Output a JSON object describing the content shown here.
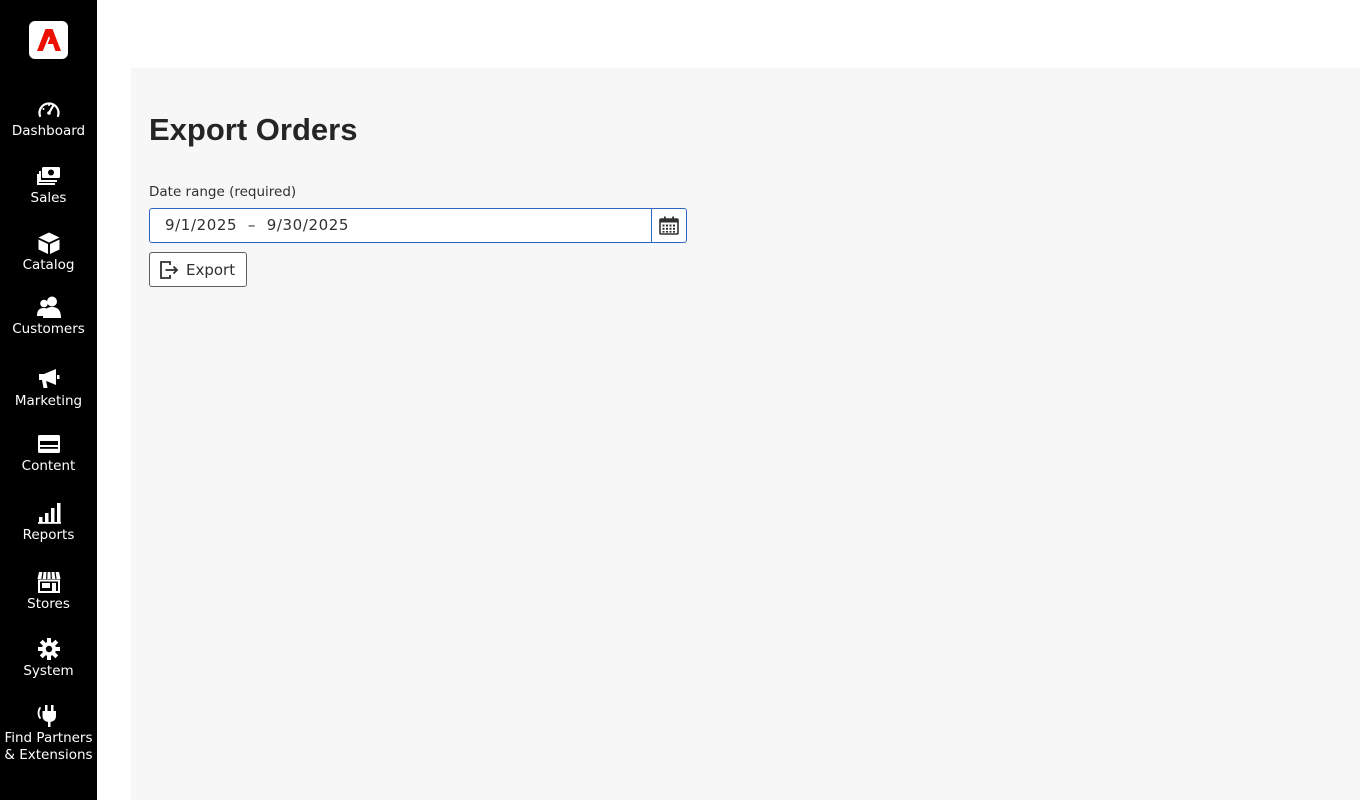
{
  "sidebar": {
    "logo": "adobe-commerce-logo",
    "items": [
      {
        "label": "Dashboard",
        "icon": "speedometer-icon"
      },
      {
        "label": "Sales",
        "icon": "money-icon"
      },
      {
        "label": "Catalog",
        "icon": "box-icon"
      },
      {
        "label": "Customers",
        "icon": "users-icon"
      },
      {
        "label": "Marketing",
        "icon": "megaphone-icon"
      },
      {
        "label": "Content",
        "icon": "layout-icon"
      },
      {
        "label": "Reports",
        "icon": "bar-chart-icon"
      },
      {
        "label": "Stores",
        "icon": "storefront-icon"
      },
      {
        "label": "System",
        "icon": "gear-icon"
      },
      {
        "label": "Find Partners",
        "label2": "& Extensions",
        "icon": "plug-icon"
      }
    ]
  },
  "main": {
    "title": "Export Orders",
    "date_range": {
      "label": "Date range (required)",
      "value": "9/1/2025  –  9/30/2025"
    },
    "export_button": {
      "label": "Export",
      "icon": "export-icon"
    }
  },
  "colors": {
    "sidebar_bg": "#000000",
    "content_bg": "#f7f7f7",
    "focus_border": "#2f66c6",
    "logo_red": "#eb1000"
  }
}
